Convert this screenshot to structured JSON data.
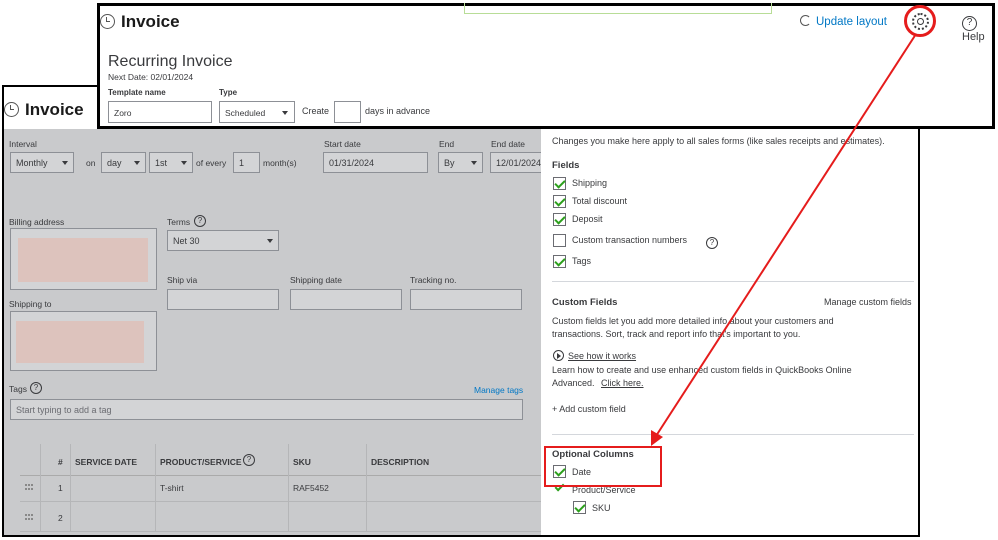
{
  "front": {
    "title": "Invoice",
    "update_layout": "Update layout",
    "help": "Help",
    "recurring_title": "Recurring Invoice",
    "next_date": "Next Date: 02/01/2024",
    "template_name_label": "Template name",
    "template_name_value": "Zoro",
    "type_label": "Type",
    "type_value": "Scheduled",
    "create_label": "Create",
    "create_value": "",
    "days_label": "days in advance"
  },
  "back": {
    "title": "Invoice",
    "interval_label": "Interval",
    "interval_value": "Monthly",
    "on_label": "on",
    "on_value": "day",
    "day_value": "1st",
    "of_every_label": "of every",
    "every_value": "1",
    "months_label": "month(s)",
    "start_date_label": "Start date",
    "start_date_value": "01/31/2024",
    "end_label": "End",
    "end_value": "By",
    "end_date_label": "End date",
    "end_date_value": "12/01/2024",
    "billing_address_label": "Billing address",
    "terms_label": "Terms",
    "terms_value": "Net 30",
    "ship_via_label": "Ship via",
    "shipping_date_label": "Shipping date",
    "tracking_label": "Tracking no.",
    "shipping_to_label": "Shipping to",
    "tags_label": "Tags",
    "manage_tags": "Manage tags",
    "tags_placeholder": "Start typing to add a tag",
    "table": {
      "headers": [
        "#",
        "SERVICE DATE",
        "PRODUCT/SERVICE",
        "SKU",
        "DESCRIPTION"
      ],
      "rows": [
        {
          "num": "1",
          "service_date": "",
          "product": "T-shirt",
          "sku": "RAF5452",
          "description": ""
        },
        {
          "num": "2",
          "service_date": "",
          "product": "",
          "sku": "",
          "description": ""
        }
      ]
    }
  },
  "panel": {
    "intro": "Changes you make here apply to all sales forms (like sales receipts and estimates).",
    "fields_heading": "Fields",
    "fields": [
      {
        "label": "Shipping",
        "checked": true
      },
      {
        "label": "Total discount",
        "checked": true
      },
      {
        "label": "Deposit",
        "checked": true
      },
      {
        "label": "Custom transaction numbers",
        "checked": false
      },
      {
        "label": "Tags",
        "checked": true
      }
    ],
    "custom_fields_heading": "Custom Fields",
    "manage_custom_fields": "Manage custom fields",
    "custom_fields_desc_1": "Custom fields let you add more detailed info about your customers and",
    "custom_fields_desc_2": "transactions. Sort, track and report info that's important to you.",
    "see_how": "See how it works",
    "learn_1": "Learn how to create and use enhanced custom fields in QuickBooks Online",
    "learn_2": "Advanced.",
    "click_here": "Click here.",
    "add_custom_field": "+ Add custom field",
    "optional_heading": "Optional Columns",
    "optional": [
      {
        "label": "Date",
        "checked": true
      },
      {
        "label": "Product/Service",
        "checked": true
      },
      {
        "label": "SKU",
        "checked": true
      }
    ]
  },
  "colors": {
    "annotation": "#e51c1c",
    "link": "#0077c5",
    "check": "#2ca01c",
    "overlay": "#c9cacc"
  }
}
